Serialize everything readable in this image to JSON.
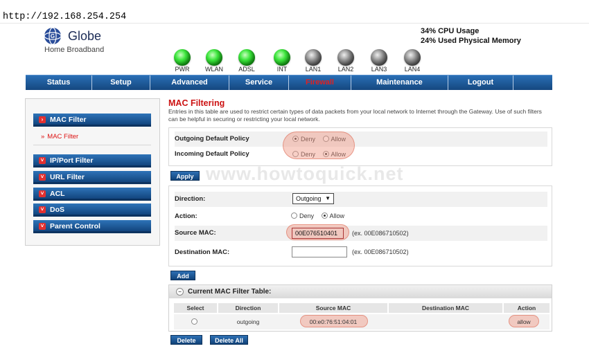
{
  "browser": {
    "url": "http://192.168.254.254"
  },
  "brand": {
    "name": "Globe",
    "subtitle": "Home Broadband"
  },
  "system": {
    "cpu": "34% CPU Usage",
    "memory": "24% Used Physical Memory"
  },
  "leds": [
    {
      "label": "PWR",
      "state": "on"
    },
    {
      "label": "WLAN",
      "state": "on"
    },
    {
      "label": "ADSL",
      "state": "on"
    },
    {
      "label": "INT",
      "state": "on"
    },
    {
      "label": "LAN1",
      "state": "off"
    },
    {
      "label": "LAN2",
      "state": "off"
    },
    {
      "label": "LAN3",
      "state": "off"
    },
    {
      "label": "LAN4",
      "state": "off"
    }
  ],
  "nav": {
    "items": [
      "Status",
      "Setup",
      "Advanced",
      "Service",
      "Firewall",
      "Maintenance",
      "Logout"
    ],
    "active": "Firewall"
  },
  "sidebar": {
    "mac_filter": "MAC Filter",
    "mac_filter_sub": "MAC Filter",
    "ip_port_filter": "IP/Port Filter",
    "url_filter": "URL Filter",
    "acl": "ACL",
    "dos": "DoS",
    "parent_control": "Parent Control"
  },
  "page": {
    "title": "MAC Filtering",
    "description": "Entries in this table are used to restrict certain types of data packets from your local network to Internet through the Gateway. Use of such filters can be helpful in securing or restricting your local network."
  },
  "policy": {
    "outgoing_label": "Outgoing Default Policy",
    "incoming_label": "Incoming Default Policy",
    "deny": "Deny",
    "allow": "Allow",
    "outgoing_value": "Deny",
    "incoming_value": "Allow",
    "apply": "Apply"
  },
  "watermark": "www.howtoquick.net",
  "form": {
    "direction_label": "Direction:",
    "direction_value": "Outgoing",
    "action_label": "Action:",
    "action_deny": "Deny",
    "action_allow": "Allow",
    "action_value": "Allow",
    "source_label": "Source MAC:",
    "source_value": "00E076510401",
    "source_hint": "(ex. 00E086710502)",
    "dest_label": "Destination MAC:",
    "dest_value": "",
    "dest_hint": "(ex. 00E086710502)",
    "add": "Add"
  },
  "table": {
    "title": "Current MAC Filter Table:",
    "headers": [
      "Select",
      "Direction",
      "Source MAC",
      "Destination MAC",
      "Action"
    ],
    "rows": [
      {
        "direction": "outgoing",
        "source": "00:e0:76:51:04:01",
        "destination": "",
        "action": "allow"
      }
    ],
    "delete": "Delete",
    "delete_all": "Delete All"
  },
  "colors": {
    "nav_blue": "#15477f",
    "accent_red": "#cc1111",
    "highlight": "#f0a090"
  }
}
